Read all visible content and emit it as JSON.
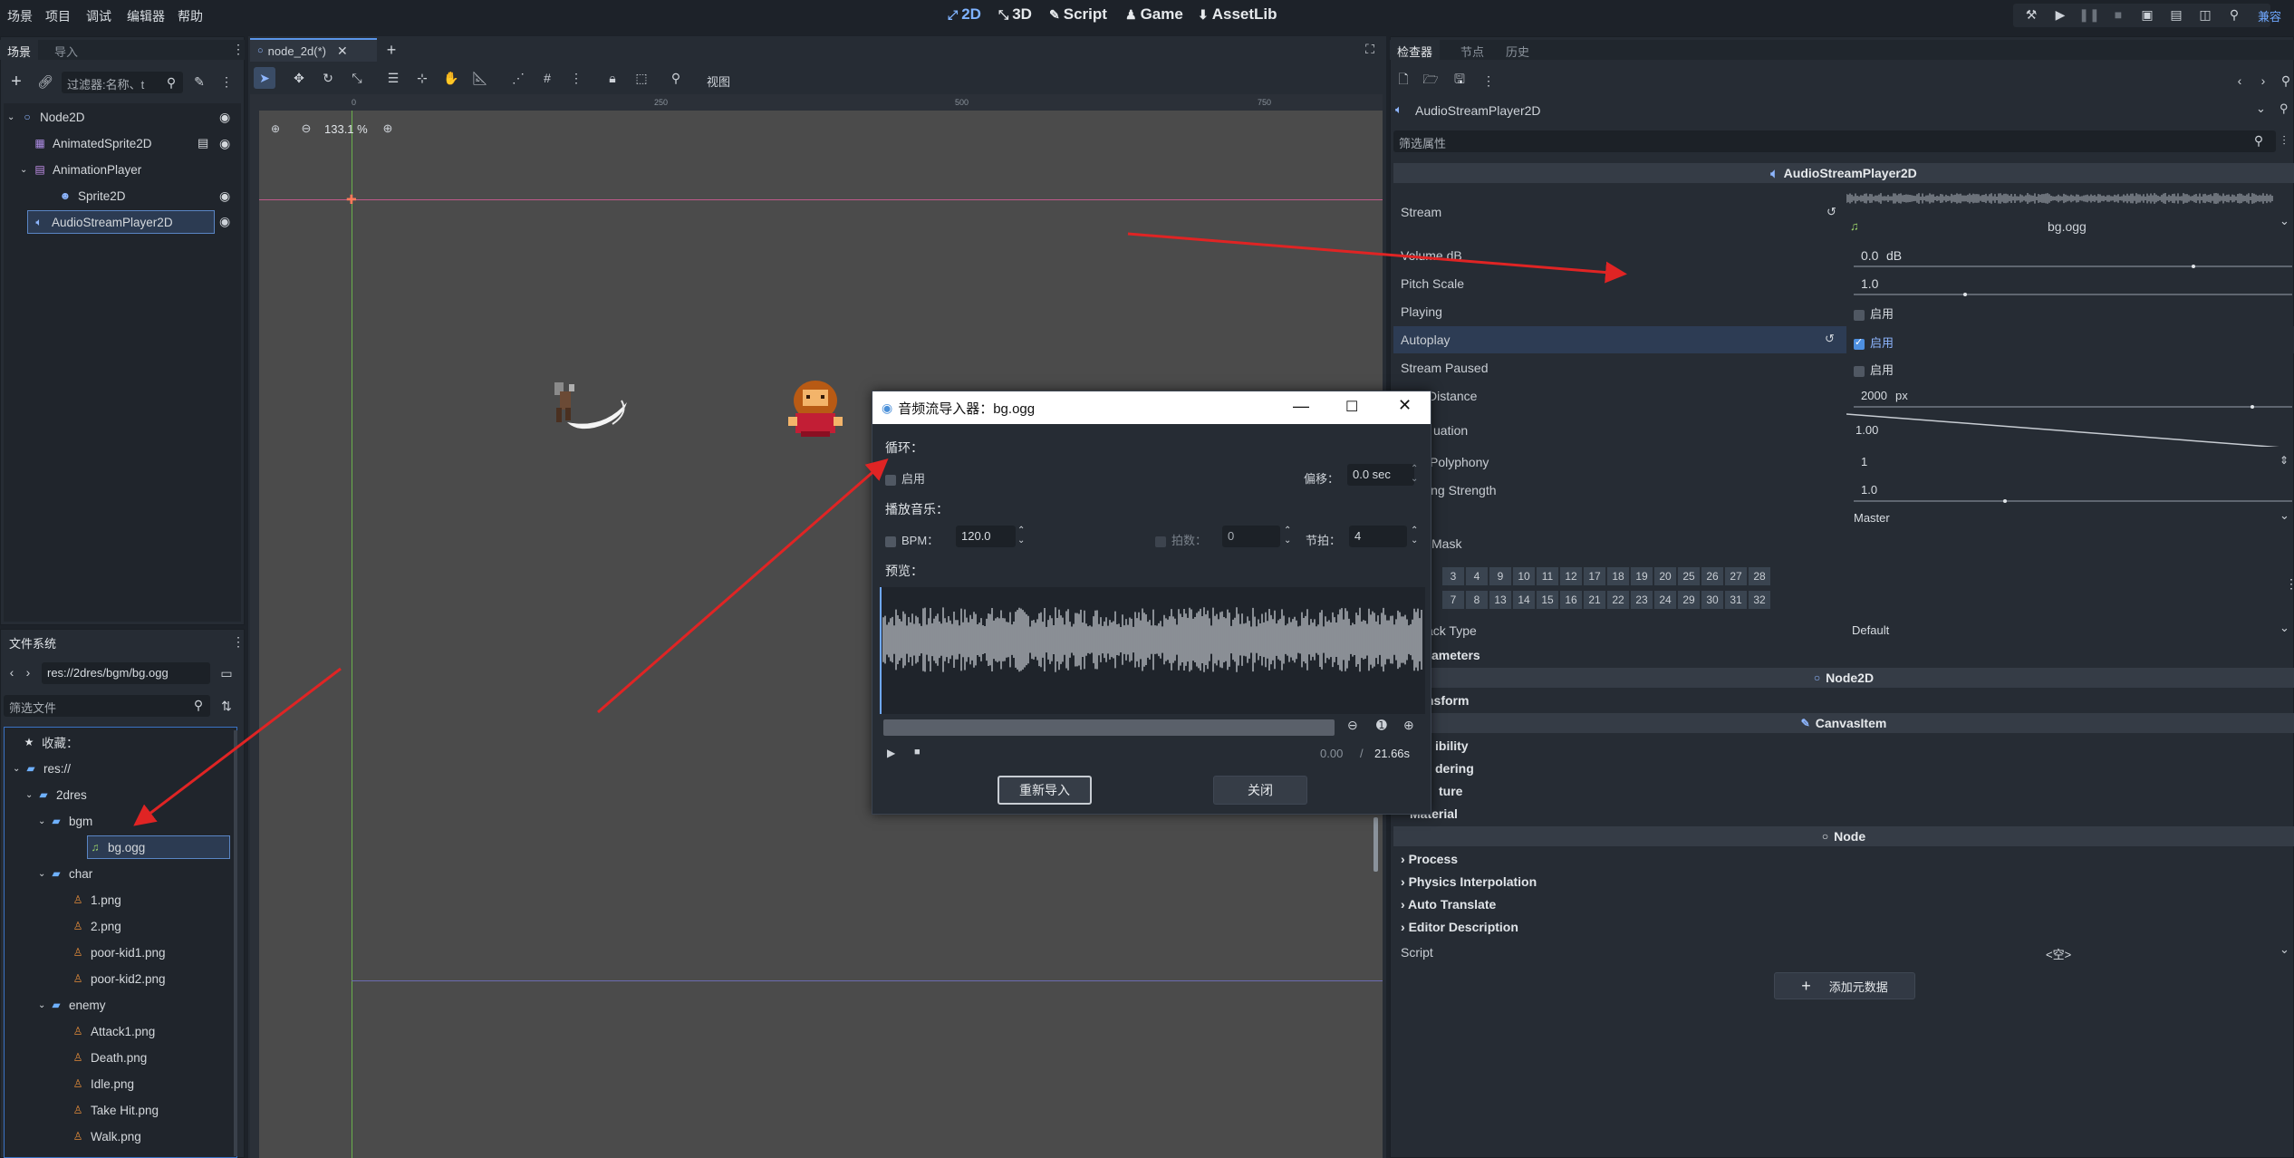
{
  "menu": [
    "场景",
    "项目",
    "调试",
    "编辑器",
    "帮助"
  ],
  "workspaces": [
    {
      "label": "2D",
      "icon": "2d-icon",
      "active": true
    },
    {
      "label": "3D",
      "icon": "3d-icon"
    },
    {
      "label": "Script",
      "icon": "script-icon"
    },
    {
      "label": "Game",
      "icon": "game-icon"
    },
    {
      "label": "AssetLib",
      "icon": "assetlib-icon"
    }
  ],
  "renderer_label": "兼容",
  "scene_dock": {
    "tabs": [
      "场景",
      "导入"
    ],
    "filter_placeholder": "过滤器:名称、t",
    "nodes": [
      {
        "label": "Node2D",
        "indent": 0
      },
      {
        "label": "AnimatedSprite2D",
        "indent": 1
      },
      {
        "label": "AnimationPlayer",
        "indent": 1
      },
      {
        "label": "Sprite2D",
        "indent": 2
      },
      {
        "label": "AudioStreamPlayer2D",
        "indent": 1,
        "selected": true
      }
    ]
  },
  "filesystem": {
    "title": "文件系统",
    "path": "res://2dres/bgm/bg.ogg",
    "filter_placeholder": "筛选文件",
    "items": [
      {
        "label": "收藏：",
        "indent": 0,
        "icon": "star-icon"
      },
      {
        "label": "res://",
        "indent": 0,
        "icon": "folder-icon"
      },
      {
        "label": "2dres",
        "indent": 1,
        "icon": "folder-icon"
      },
      {
        "label": "bgm",
        "indent": 2,
        "icon": "folder-icon"
      },
      {
        "label": "bg.ogg",
        "indent": 3,
        "icon": "audio-file-icon",
        "selected": true
      },
      {
        "label": "char",
        "indent": 2,
        "icon": "folder-icon"
      },
      {
        "label": "1.png",
        "indent": 3,
        "icon": "image-file-icon"
      },
      {
        "label": "2.png",
        "indent": 3,
        "icon": "image-file-icon"
      },
      {
        "label": "poor-kid1.png",
        "indent": 3,
        "icon": "image-file-icon"
      },
      {
        "label": "poor-kid2.png",
        "indent": 3,
        "icon": "image-file-icon"
      },
      {
        "label": "enemy",
        "indent": 2,
        "icon": "folder-icon"
      },
      {
        "label": "Attack1.png",
        "indent": 3,
        "icon": "image-file-icon"
      },
      {
        "label": "Death.png",
        "indent": 3,
        "icon": "image-file-icon"
      },
      {
        "label": "Idle.png",
        "indent": 3,
        "icon": "image-file-icon"
      },
      {
        "label": "Take Hit.png",
        "indent": 3,
        "icon": "image-file-icon"
      },
      {
        "label": "Walk.png",
        "indent": 3,
        "icon": "image-file-icon"
      }
    ]
  },
  "editor": {
    "tab_label": "node_2d(*)",
    "toolbar_view": "视图",
    "zoom": "133.1 %",
    "ruler_ticks": [
      "0",
      "250",
      "500",
      "750"
    ]
  },
  "inspector": {
    "tabs": [
      "检查器",
      "节点",
      "历史"
    ],
    "object_name": "AudioStreamPlayer2D",
    "filter_placeholder": "筛选属性",
    "class_header": "AudioStreamPlayer2D",
    "stream_file": "bg.ogg",
    "props": {
      "stream": "Stream",
      "volume": "Volume dB",
      "volume_val": "0.0",
      "volume_unit": "dB",
      "volume_level": 0.77,
      "pitch": "Pitch Scale",
      "pitch_val": "1.0",
      "pitch_level": 0.25,
      "playing": "Playing",
      "autoplay": "Autoplay",
      "paused": "Stream Paused",
      "max_distance": "Distance",
      "max_distance_val": "2000",
      "max_distance_unit": "px",
      "attenuation": "uation",
      "attenuation_val": "1.00",
      "polyphony": "Polyphony",
      "polyphony_val": "1",
      "panning": "ing Strength",
      "panning_val": "1.0",
      "panning_level": 0.34,
      "bus_val": "Master",
      "area_mask": "Mask",
      "playback_type": "ack Type",
      "playback_val": "Default",
      "parameters": "ameters",
      "check_label": "启用"
    },
    "area_mask_row1": [
      "3",
      "4",
      "9",
      "10",
      "11",
      "12",
      "17",
      "18",
      "19",
      "20",
      "25",
      "26",
      "27",
      "28"
    ],
    "area_mask_row2": [
      "7",
      "8",
      "13",
      "14",
      "15",
      "16",
      "21",
      "22",
      "23",
      "24",
      "29",
      "30",
      "31",
      "32"
    ],
    "node2d_header": "Node2D",
    "transform": "nsform",
    "canvasitem_header": "CanvasItem",
    "canvas_groups": [
      "ibility",
      "dering",
      "ture",
      "Material"
    ],
    "node_header": "Node",
    "node_groups": [
      "Process",
      "Physics Interpolation",
      "Auto Translate",
      "Editor Description"
    ],
    "script_label": "Script",
    "script_val": "<空>",
    "add_metadata": "添加元数据"
  },
  "dialog": {
    "title": "音频流导入器：bg.ogg",
    "loop_section": "循环：",
    "loop_enable": "启用",
    "offset_label": "偏移：",
    "offset_val": "0.0 sec",
    "music_section": "播放音乐：",
    "bpm_label": "BPM：",
    "bpm_val": "120.0",
    "beats_label": "拍数：",
    "beats_val": "0",
    "bar_label": "节拍：",
    "bar_val": "4",
    "preview_section": "预览：",
    "time_current": "0.00",
    "time_sep": "/",
    "time_total": "21.66s",
    "reimport": "重新导入",
    "close": "关闭"
  }
}
